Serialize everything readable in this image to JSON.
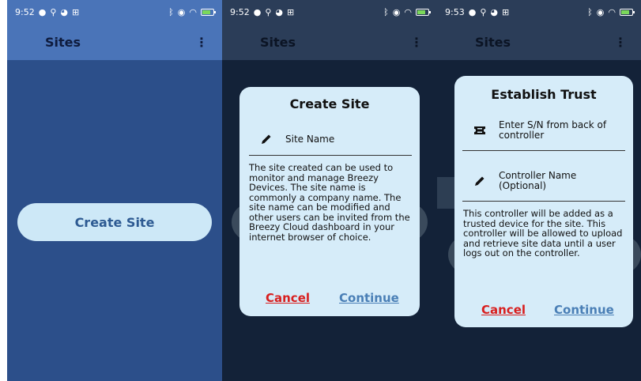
{
  "status_bars": [
    {
      "time": "9:52"
    },
    {
      "time": "9:52"
    },
    {
      "time": "9:53"
    }
  ],
  "appbar": {
    "title": "Sites",
    "menu": "⋮"
  },
  "screen1": {
    "create_site_button": "Create Site"
  },
  "create_site_dialog": {
    "title": "Create Site",
    "field_label": "Site Name",
    "description": "The site created can be used to monitor and manage Breezy Devices. The site name is commonly a company name. The site name can be modified and other users can be invited from the Breezy Cloud dashboard in your internet browser of choice.",
    "cancel": "Cancel",
    "continue": "Continue"
  },
  "trust_dialog": {
    "title": "Establish Trust",
    "serial_label": "Enter S/N from back of controller",
    "name_label": "Controller Name (Optional)",
    "description": "This controller will be added as a trusted device for the site. This controller will be allowed to upload and retrieve site data until a user logs out on the controller.",
    "cancel": "Cancel",
    "continue": "Continue"
  },
  "icons": {
    "pencil": "pencil-icon",
    "ticket": "ticket-icon",
    "menu": "more-vert-icon"
  },
  "colors": {
    "primary": "#4a74b8",
    "background": "#2c4f8a",
    "dialog": "#d6ecf9",
    "cancel": "#d81f1f",
    "continue": "#4a7fb6"
  }
}
